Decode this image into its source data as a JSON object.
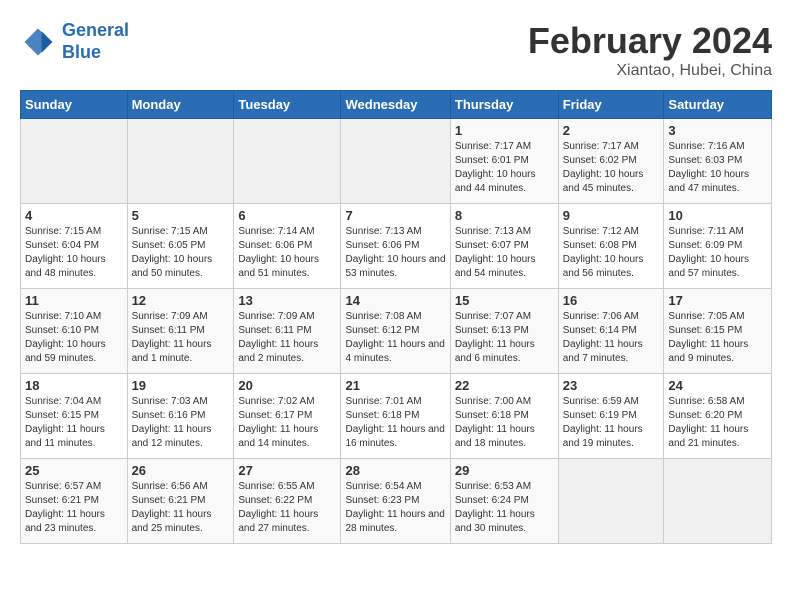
{
  "header": {
    "logo_line1": "General",
    "logo_line2": "Blue",
    "month_year": "February 2024",
    "location": "Xiantao, Hubei, China"
  },
  "weekdays": [
    "Sunday",
    "Monday",
    "Tuesday",
    "Wednesday",
    "Thursday",
    "Friday",
    "Saturday"
  ],
  "weeks": [
    [
      {
        "day": "",
        "info": ""
      },
      {
        "day": "",
        "info": ""
      },
      {
        "day": "",
        "info": ""
      },
      {
        "day": "",
        "info": ""
      },
      {
        "day": "1",
        "info": "Sunrise: 7:17 AM\nSunset: 6:01 PM\nDaylight: 10 hours\nand 44 minutes."
      },
      {
        "day": "2",
        "info": "Sunrise: 7:17 AM\nSunset: 6:02 PM\nDaylight: 10 hours\nand 45 minutes."
      },
      {
        "day": "3",
        "info": "Sunrise: 7:16 AM\nSunset: 6:03 PM\nDaylight: 10 hours\nand 47 minutes."
      }
    ],
    [
      {
        "day": "4",
        "info": "Sunrise: 7:15 AM\nSunset: 6:04 PM\nDaylight: 10 hours\nand 48 minutes."
      },
      {
        "day": "5",
        "info": "Sunrise: 7:15 AM\nSunset: 6:05 PM\nDaylight: 10 hours\nand 50 minutes."
      },
      {
        "day": "6",
        "info": "Sunrise: 7:14 AM\nSunset: 6:06 PM\nDaylight: 10 hours\nand 51 minutes."
      },
      {
        "day": "7",
        "info": "Sunrise: 7:13 AM\nSunset: 6:06 PM\nDaylight: 10 hours\nand 53 minutes."
      },
      {
        "day": "8",
        "info": "Sunrise: 7:13 AM\nSunset: 6:07 PM\nDaylight: 10 hours\nand 54 minutes."
      },
      {
        "day": "9",
        "info": "Sunrise: 7:12 AM\nSunset: 6:08 PM\nDaylight: 10 hours\nand 56 minutes."
      },
      {
        "day": "10",
        "info": "Sunrise: 7:11 AM\nSunset: 6:09 PM\nDaylight: 10 hours\nand 57 minutes."
      }
    ],
    [
      {
        "day": "11",
        "info": "Sunrise: 7:10 AM\nSunset: 6:10 PM\nDaylight: 10 hours\nand 59 minutes."
      },
      {
        "day": "12",
        "info": "Sunrise: 7:09 AM\nSunset: 6:11 PM\nDaylight: 11 hours\nand 1 minute."
      },
      {
        "day": "13",
        "info": "Sunrise: 7:09 AM\nSunset: 6:11 PM\nDaylight: 11 hours\nand 2 minutes."
      },
      {
        "day": "14",
        "info": "Sunrise: 7:08 AM\nSunset: 6:12 PM\nDaylight: 11 hours\nand 4 minutes."
      },
      {
        "day": "15",
        "info": "Sunrise: 7:07 AM\nSunset: 6:13 PM\nDaylight: 11 hours\nand 6 minutes."
      },
      {
        "day": "16",
        "info": "Sunrise: 7:06 AM\nSunset: 6:14 PM\nDaylight: 11 hours\nand 7 minutes."
      },
      {
        "day": "17",
        "info": "Sunrise: 7:05 AM\nSunset: 6:15 PM\nDaylight: 11 hours\nand 9 minutes."
      }
    ],
    [
      {
        "day": "18",
        "info": "Sunrise: 7:04 AM\nSunset: 6:15 PM\nDaylight: 11 hours\nand 11 minutes."
      },
      {
        "day": "19",
        "info": "Sunrise: 7:03 AM\nSunset: 6:16 PM\nDaylight: 11 hours\nand 12 minutes."
      },
      {
        "day": "20",
        "info": "Sunrise: 7:02 AM\nSunset: 6:17 PM\nDaylight: 11 hours\nand 14 minutes."
      },
      {
        "day": "21",
        "info": "Sunrise: 7:01 AM\nSunset: 6:18 PM\nDaylight: 11 hours\nand 16 minutes."
      },
      {
        "day": "22",
        "info": "Sunrise: 7:00 AM\nSunset: 6:18 PM\nDaylight: 11 hours\nand 18 minutes."
      },
      {
        "day": "23",
        "info": "Sunrise: 6:59 AM\nSunset: 6:19 PM\nDaylight: 11 hours\nand 19 minutes."
      },
      {
        "day": "24",
        "info": "Sunrise: 6:58 AM\nSunset: 6:20 PM\nDaylight: 11 hours\nand 21 minutes."
      }
    ],
    [
      {
        "day": "25",
        "info": "Sunrise: 6:57 AM\nSunset: 6:21 PM\nDaylight: 11 hours\nand 23 minutes."
      },
      {
        "day": "26",
        "info": "Sunrise: 6:56 AM\nSunset: 6:21 PM\nDaylight: 11 hours\nand 25 minutes."
      },
      {
        "day": "27",
        "info": "Sunrise: 6:55 AM\nSunset: 6:22 PM\nDaylight: 11 hours\nand 27 minutes."
      },
      {
        "day": "28",
        "info": "Sunrise: 6:54 AM\nSunset: 6:23 PM\nDaylight: 11 hours\nand 28 minutes."
      },
      {
        "day": "29",
        "info": "Sunrise: 6:53 AM\nSunset: 6:24 PM\nDaylight: 11 hours\nand 30 minutes."
      },
      {
        "day": "",
        "info": ""
      },
      {
        "day": "",
        "info": ""
      }
    ]
  ]
}
